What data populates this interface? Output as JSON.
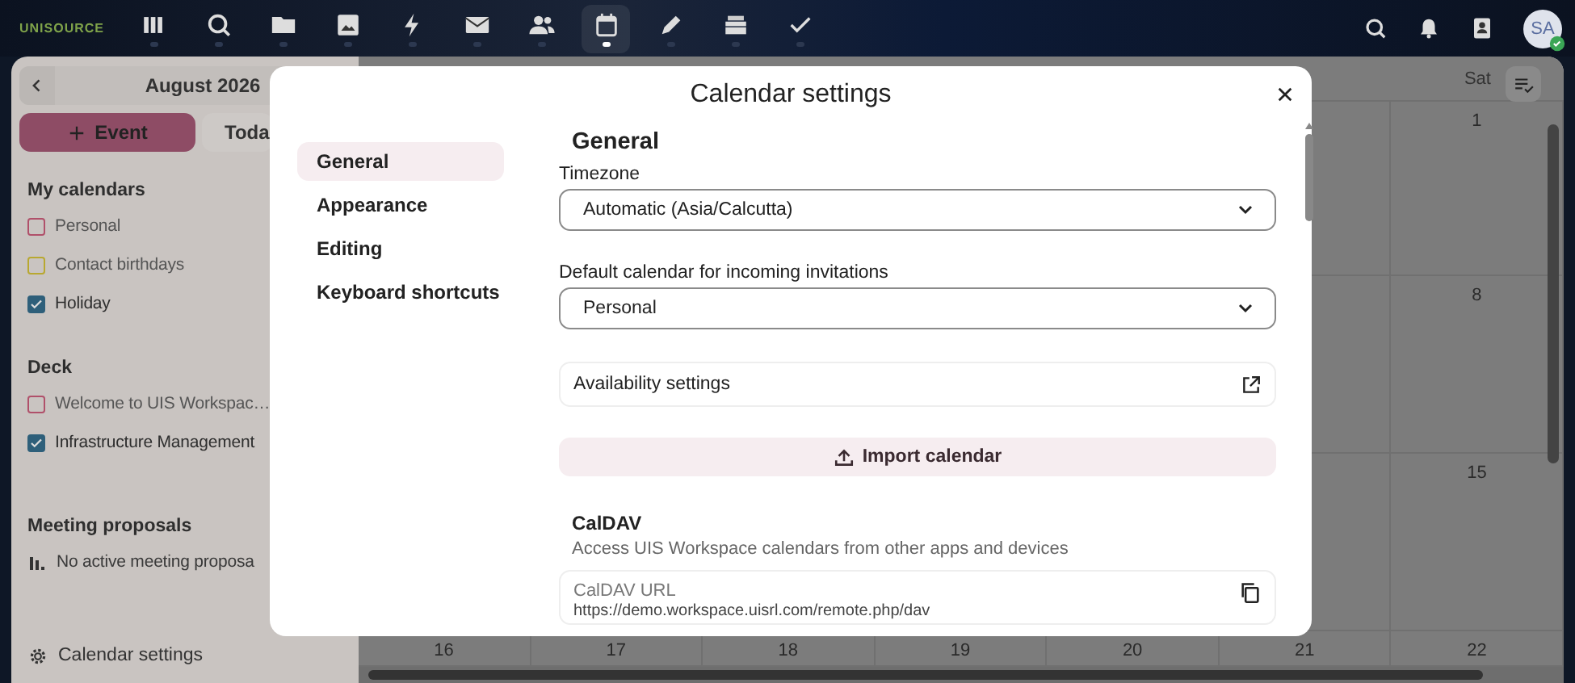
{
  "top_bar": {
    "logo": "UNISOURCE",
    "apps": [
      {
        "kind": "dashboard",
        "selected": false
      },
      {
        "kind": "search",
        "selected": false
      },
      {
        "kind": "files",
        "selected": false
      },
      {
        "kind": "photos",
        "selected": false
      },
      {
        "kind": "activity",
        "selected": false
      },
      {
        "kind": "mail",
        "selected": false
      },
      {
        "kind": "contacts",
        "selected": false
      },
      {
        "kind": "calendar",
        "selected": true
      },
      {
        "kind": "notes",
        "selected": false
      },
      {
        "kind": "deck",
        "selected": false
      },
      {
        "kind": "tasks",
        "selected": false
      }
    ],
    "avatar": "SA"
  },
  "sidebar": {
    "month": "August 2026",
    "new_event": "Event",
    "today": "Toda",
    "sections": [
      {
        "title": "My calendars",
        "items": [
          {
            "label": "Personal",
            "checked": false,
            "color": "#b0506a"
          },
          {
            "label": "Contact birthdays",
            "checked": false,
            "color": "#b8a830"
          },
          {
            "label": "Holiday",
            "checked": true,
            "color": "#2e5f7a"
          }
        ]
      },
      {
        "title": "Deck",
        "items": [
          {
            "label": "Welcome to UIS Workspac…",
            "checked": false,
            "color": "#b0506a"
          },
          {
            "label": "Infrastructure Management",
            "checked": true,
            "color": "#2e5f7a"
          }
        ]
      }
    ],
    "proposals": {
      "title": "Meeting proposals",
      "empty": "No active meeting proposa"
    },
    "settings_link": "Calendar settings"
  },
  "calendar": {
    "weekday": "Sat",
    "rows": [
      [
        "1"
      ],
      [
        "8"
      ],
      [
        "15"
      ],
      [
        "16",
        "17",
        "18",
        "19",
        "20",
        "21",
        "22"
      ]
    ]
  },
  "dialog": {
    "title": "Calendar settings",
    "nav": [
      {
        "label": "General",
        "selected": true
      },
      {
        "label": "Appearance",
        "selected": false
      },
      {
        "label": "Editing",
        "selected": false
      },
      {
        "label": "Keyboard shortcuts",
        "selected": false
      }
    ],
    "heading": "General",
    "timezone": {
      "label": "Timezone",
      "value": "Automatic (Asia/Calcutta)"
    },
    "default_calendar": {
      "label": "Default calendar for incoming invitations",
      "value": "Personal"
    },
    "availability": "Availability settings",
    "import": "Import calendar",
    "caldav": {
      "title": "CalDAV",
      "description": "Access UIS Workspace calendars from other apps and devices",
      "url_label": "CalDAV URL",
      "url": "https://demo.workspace.uisrl.com/remote.php/dav"
    }
  }
}
